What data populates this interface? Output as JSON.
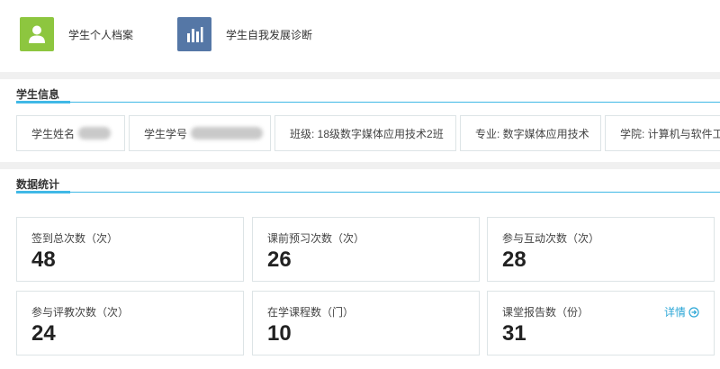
{
  "nav": {
    "items": [
      {
        "label": "学生个人档案",
        "icon": "person-icon",
        "color": "#8dc63f"
      },
      {
        "label": "学生自我发展诊断",
        "icon": "bar-chart-icon",
        "color": "#5577a6"
      }
    ]
  },
  "student_info": {
    "title": "学生信息",
    "name_label": "学生姓名",
    "id_label": "学生学号",
    "class_text": "班级: 18级数字媒体应用技术2班",
    "major_text": "专业: 数字媒体应用技术",
    "college_text": "学院: 计算机与软件工"
  },
  "stats": {
    "title": "数据统计",
    "cards": [
      {
        "label": "签到总次数（次）",
        "value": "48"
      },
      {
        "label": "课前预习次数（次）",
        "value": "26"
      },
      {
        "label": "参与互动次数（次）",
        "value": "28"
      },
      {
        "label": "参与评教次数（次）",
        "value": "24"
      },
      {
        "label": "在学课程数（门）",
        "value": "10"
      },
      {
        "label": "课堂报告数（份）",
        "value": "31",
        "link": "详情"
      }
    ]
  },
  "colors": {
    "accent": "#40b8e6",
    "link": "#2ba6d6"
  }
}
